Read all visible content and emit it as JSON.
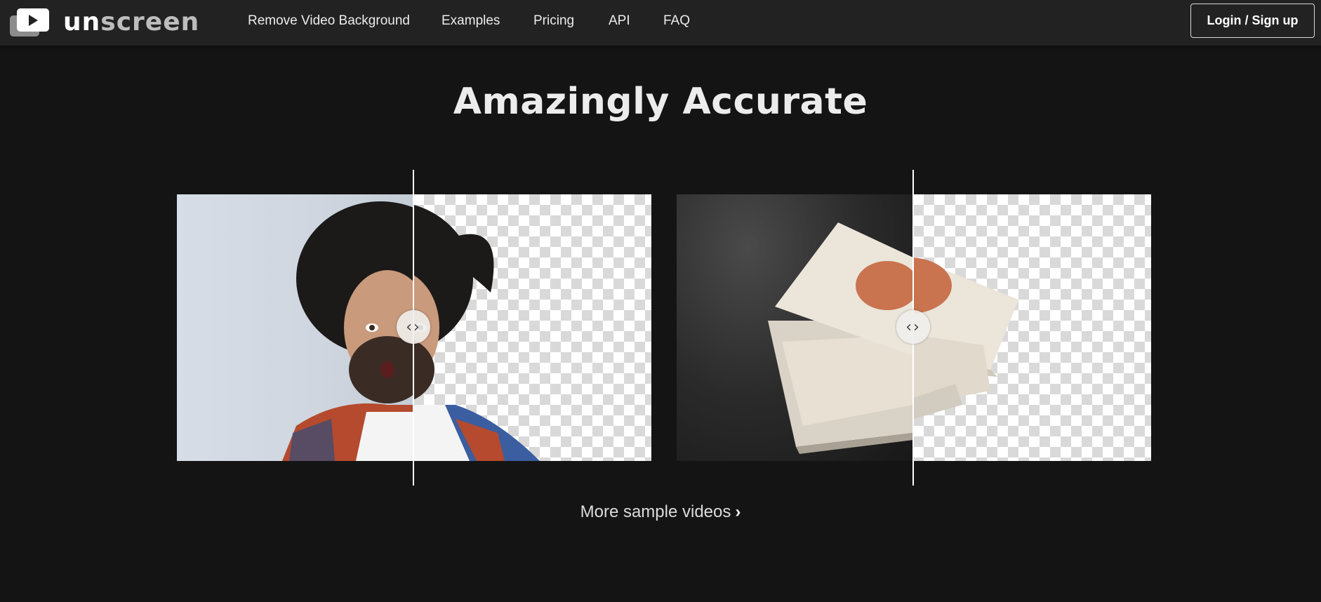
{
  "header": {
    "brand": {
      "name_bold": "un",
      "name_dim": "screen",
      "icon": "video-play-icon"
    },
    "nav": [
      {
        "label": "Remove Video Background"
      },
      {
        "label": "Examples"
      },
      {
        "label": "Pricing"
      },
      {
        "label": "API"
      },
      {
        "label": "FAQ"
      }
    ],
    "login_label": "Login / Sign up"
  },
  "main": {
    "heading": "Amazingly Accurate",
    "comparisons": [
      {
        "subject": "person-with-wild-hair",
        "handle_icon": "chevron-left-right-icon"
      },
      {
        "subject": "stack-of-books",
        "handle_icon": "chevron-left-right-icon"
      }
    ],
    "more_link": {
      "label": "More sample videos",
      "icon": "chevron-right-icon"
    }
  },
  "colors": {
    "background": "#141414",
    "topbar": "#222222",
    "text": "#ececec",
    "checker_light": "#ffffff",
    "checker_dark": "#d9d9d9"
  }
}
